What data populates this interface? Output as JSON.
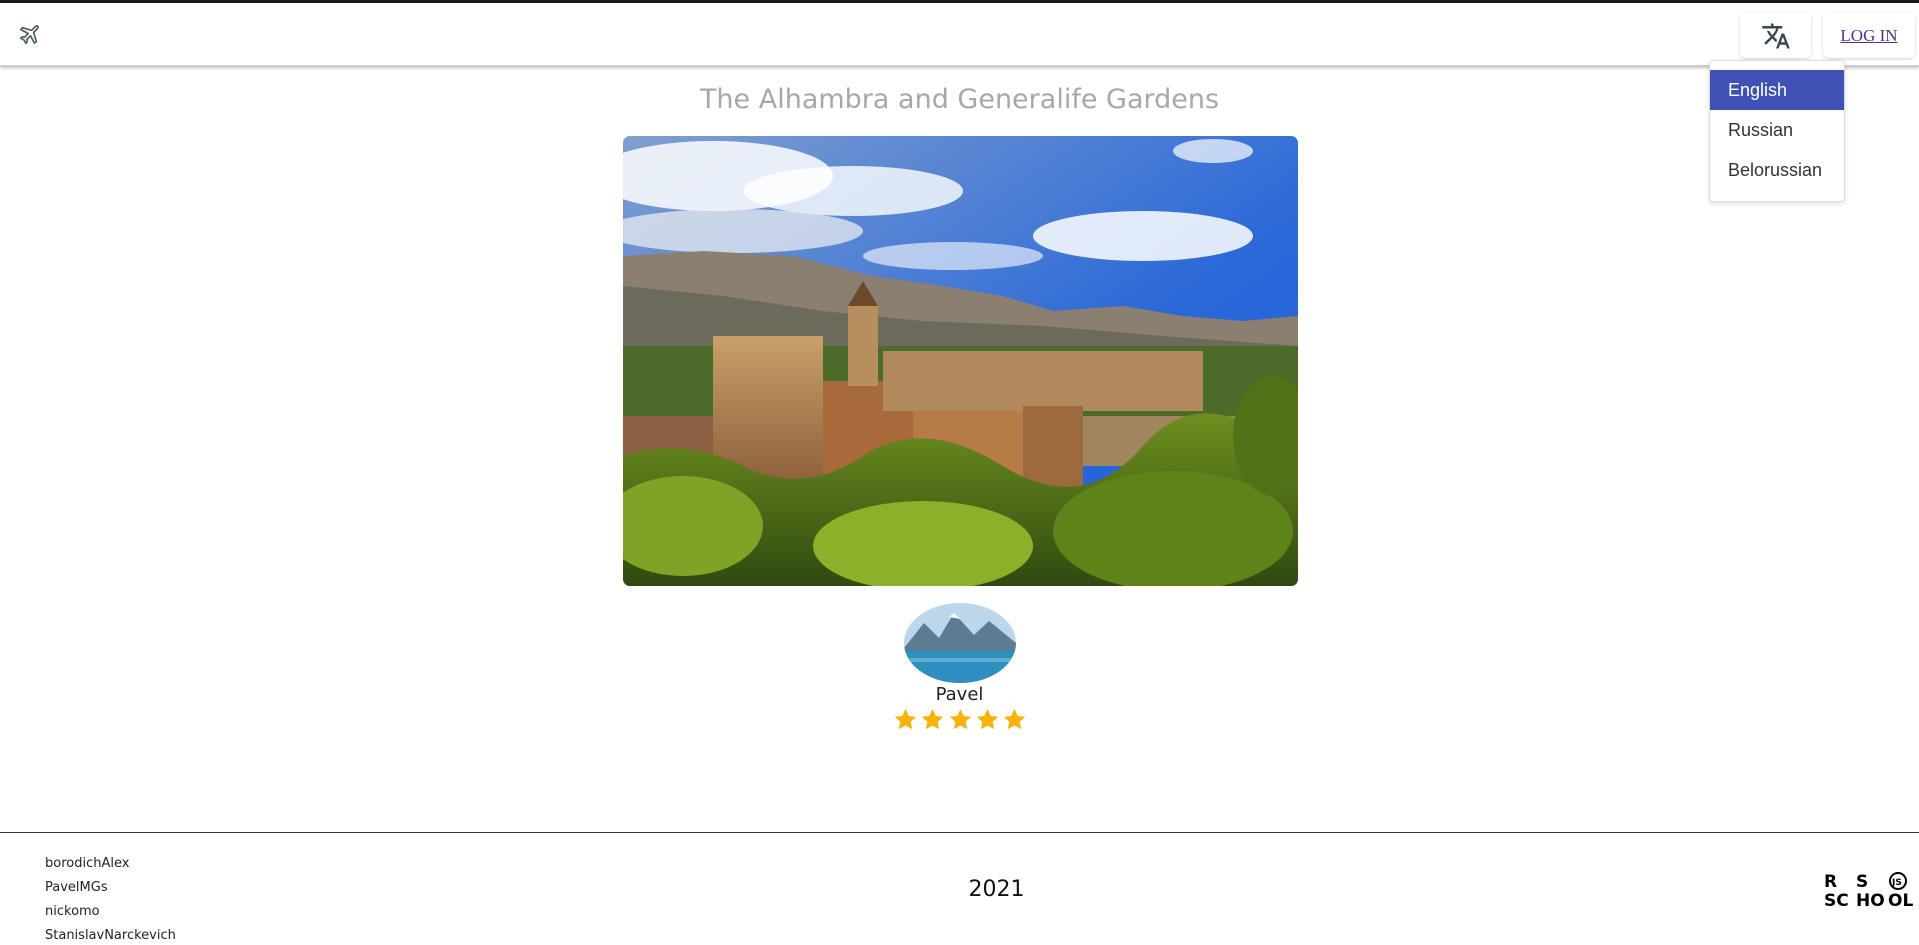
{
  "header": {
    "home_icon": "airplane-icon",
    "language_icon": "translate-icon",
    "login_label": "LOG IN",
    "language_menu": {
      "items": [
        {
          "label": "English",
          "selected": true
        },
        {
          "label": "Russian",
          "selected": false
        },
        {
          "label": "Belorussian",
          "selected": false
        }
      ]
    }
  },
  "main": {
    "place_title": "The Alhambra and Generalife Gardens",
    "photo_alt": "The Alhambra palace",
    "review": {
      "author": "Pavel",
      "rating": 5,
      "rating_max": 5,
      "star_color": "#f9b208"
    }
  },
  "footer": {
    "developers": [
      "borodichAlex",
      "PavelMGs",
      "nickomo",
      "StanislavNarckevich"
    ],
    "year": "2021",
    "logo_label": "RS SCHOOL"
  },
  "colors": {
    "accent": "#3f51b5",
    "title_gray": "#a8a8a8",
    "link": "#5a2e8c"
  }
}
